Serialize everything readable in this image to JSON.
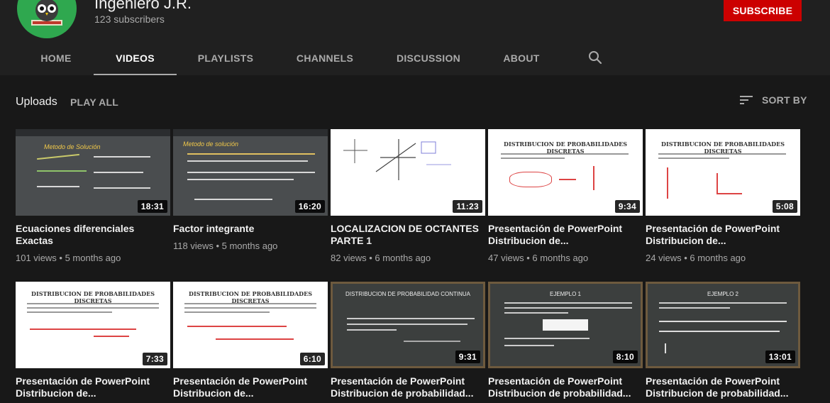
{
  "channel": {
    "name": "Ingeniero J.R.",
    "subscribers": "123 subscribers",
    "subscribe_label": "SUBSCRIBE",
    "avatar_icon": "owl-icon",
    "avatar_color": "#2fa84f"
  },
  "tabs": [
    {
      "label": "HOME"
    },
    {
      "label": "VIDEOS",
      "active": true
    },
    {
      "label": "PLAYLISTS"
    },
    {
      "label": "CHANNELS"
    },
    {
      "label": "DISCUSSION"
    },
    {
      "label": "ABOUT"
    }
  ],
  "uploads": {
    "title": "Uploads",
    "play_all": "PLAY ALL",
    "sort_by": "SORT BY"
  },
  "videos": [
    {
      "title": "Ecuaciones diferenciales Exactas",
      "views": "101 views",
      "age": "5 months ago",
      "duration": "18:31",
      "thumb_text": "Metodo de Solución"
    },
    {
      "title": "Factor integrante",
      "views": "118 views",
      "age": "5 months ago",
      "duration": "16:20",
      "thumb_text": "Metodo de solución"
    },
    {
      "title": "LOCALIZACION DE OCTANTES PARTE 1",
      "views": "82 views",
      "age": "6 months ago",
      "duration": "11:23",
      "thumb_text": ""
    },
    {
      "title": "Presentación de PowerPoint Distribucion de...",
      "views": "47 views",
      "age": "6 months ago",
      "duration": "9:34",
      "thumb_text": "DISTRIBUCION DE PROBABILIDADES DISCRETAS"
    },
    {
      "title": "Presentación de PowerPoint Distribucion de...",
      "views": "24 views",
      "age": "6 months ago",
      "duration": "5:08",
      "thumb_text": "DISTRIBUCION DE PROBABILIDADES DISCRETAS"
    },
    {
      "title": "Presentación de PowerPoint Distribucion de...",
      "views": "",
      "age": "",
      "duration": "7:33",
      "thumb_text": "DISTRIBUCION DE PROBABILIDADES DISCRETAS"
    },
    {
      "title": "Presentación de PowerPoint Distribucion de...",
      "views": "",
      "age": "",
      "duration": "6:10",
      "thumb_text": "DISTRIBUCION DE PROBABILIDADES DISCRETAS"
    },
    {
      "title": "Presentación de PowerPoint Distribucion de probabilidad...",
      "views": "",
      "age": "",
      "duration": "9:31",
      "thumb_text": "DISTRIBUCION DE PROBABILIDAD CONTINUA"
    },
    {
      "title": "Presentación de PowerPoint Distribucion de probabilidad...",
      "views": "",
      "age": "",
      "duration": "8:10",
      "thumb_text": "EJEMPLO 1"
    },
    {
      "title": "Presentación de PowerPoint Distribucion de probabilidad...",
      "views": "",
      "age": "",
      "duration": "13:01",
      "thumb_text": "EJEMPLO 2"
    }
  ],
  "colors": {
    "accent": "#cc0000",
    "background": "#181818",
    "header": "#202020"
  }
}
